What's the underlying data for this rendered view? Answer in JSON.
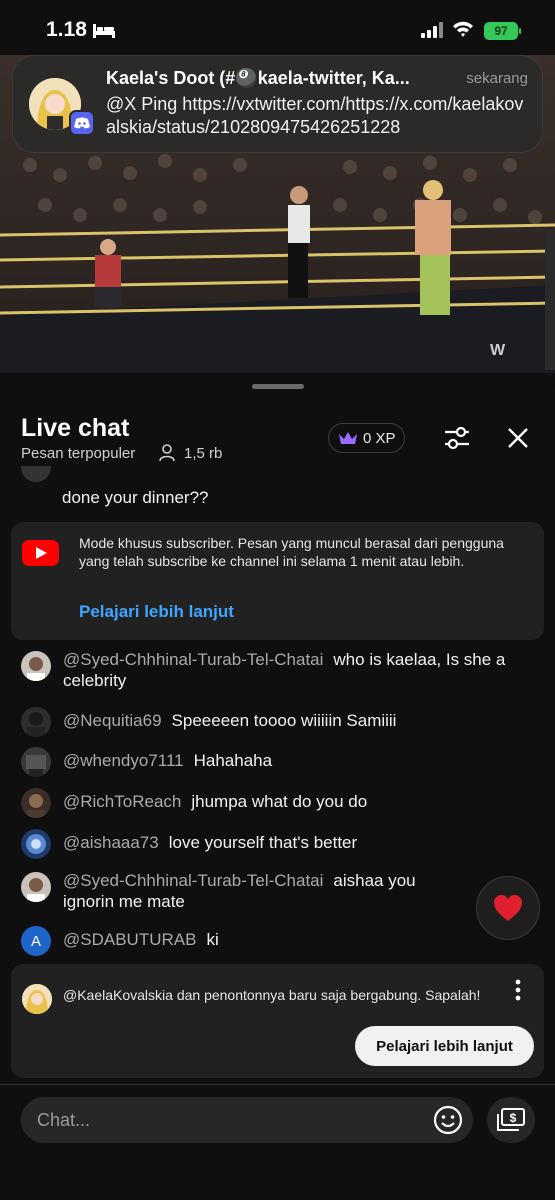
{
  "status_bar": {
    "time": "1.18",
    "battery": "97"
  },
  "notification": {
    "title": "Kaela's Doot (#🎱kaela-twitter, Ka...",
    "time": "sekarang",
    "body": "@X Ping https://vxtwitter.com/https://x.com/kaelakovalskia/status/2102809475426251228"
  },
  "chat": {
    "title": "Live chat",
    "mode": "Pesan terpopuler",
    "viewers": "1,5 rb",
    "xp": "0 XP",
    "partial_message": "done your dinner??",
    "subscriber_notice": {
      "text": "Mode khusus subscriber. Pesan yang muncul berasal dari pengguna yang telah subscribe ke channel ini selama 1 menit atau lebih.",
      "link": "Pelajari lebih lanjut"
    },
    "messages": [
      {
        "author": "@Syed-Chhhinal-Turab-Tel-Chatai",
        "text": "who is kaelaa, Is she a celebrity"
      },
      {
        "author": "@Nequitia69",
        "text": "Speeeeen toooo wiiiiin Samiiii"
      },
      {
        "author": "@whendyo7111",
        "text": "Hahahaha"
      },
      {
        "author": "@RichToReach",
        "text": "jhumpa what do you do"
      },
      {
        "author": "@aishaaa73",
        "text": "love yourself that's better"
      },
      {
        "author": "@Syed-Chhhinal-Turab-Tel-Chatai",
        "text": "aishaa you ignorin me mate"
      },
      {
        "author": "@SDABUTURAB",
        "text": "ki",
        "avatar_letter": "A"
      }
    ],
    "join_notice": {
      "text": "@KaelaKovalskia dan penontonnya baru saja bergabung. Sapalah!",
      "button": "Pelajari lebih lanjut"
    },
    "input_placeholder": "Chat..."
  },
  "colors": {
    "background": "#0f0f0f",
    "card": "#212121",
    "link": "#3ea6ff",
    "youtube_red": "#ff0000",
    "battery_green": "#34c759",
    "discord": "#5865f2"
  },
  "icons": [
    "bed-icon",
    "signal-icon",
    "wifi-icon",
    "discord-icon",
    "viewer-icon",
    "crown-icon",
    "filter-icon",
    "close-icon",
    "youtube-icon",
    "heart-icon",
    "kebab-icon",
    "emoji-icon",
    "superchat-icon"
  ]
}
